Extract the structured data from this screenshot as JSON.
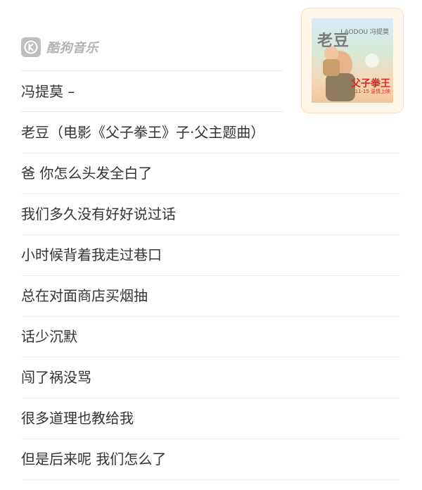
{
  "brand": {
    "name": "酷狗音乐",
    "icon": "kugou-logo-icon",
    "color": "#b3b3b3"
  },
  "artist_line": "冯提莫 –",
  "album": {
    "cover_title": "老豆",
    "cover_subtitle": "LAODOU 冯提莫",
    "cover_art_title": "父子拳王",
    "cover_art_caption": "11·15 温情上映"
  },
  "lyrics": [
    "老豆（电影《父子拳王》子·父主题曲）",
    "爸 你怎么头发全白了",
    "我们多久没有好好说过话",
    "小时候背着我走过巷口",
    "总在对面商店买烟抽",
    "话少沉默",
    "闯了祸没骂",
    "很多道理也教给我",
    "但是后来呢 我们怎么了"
  ]
}
